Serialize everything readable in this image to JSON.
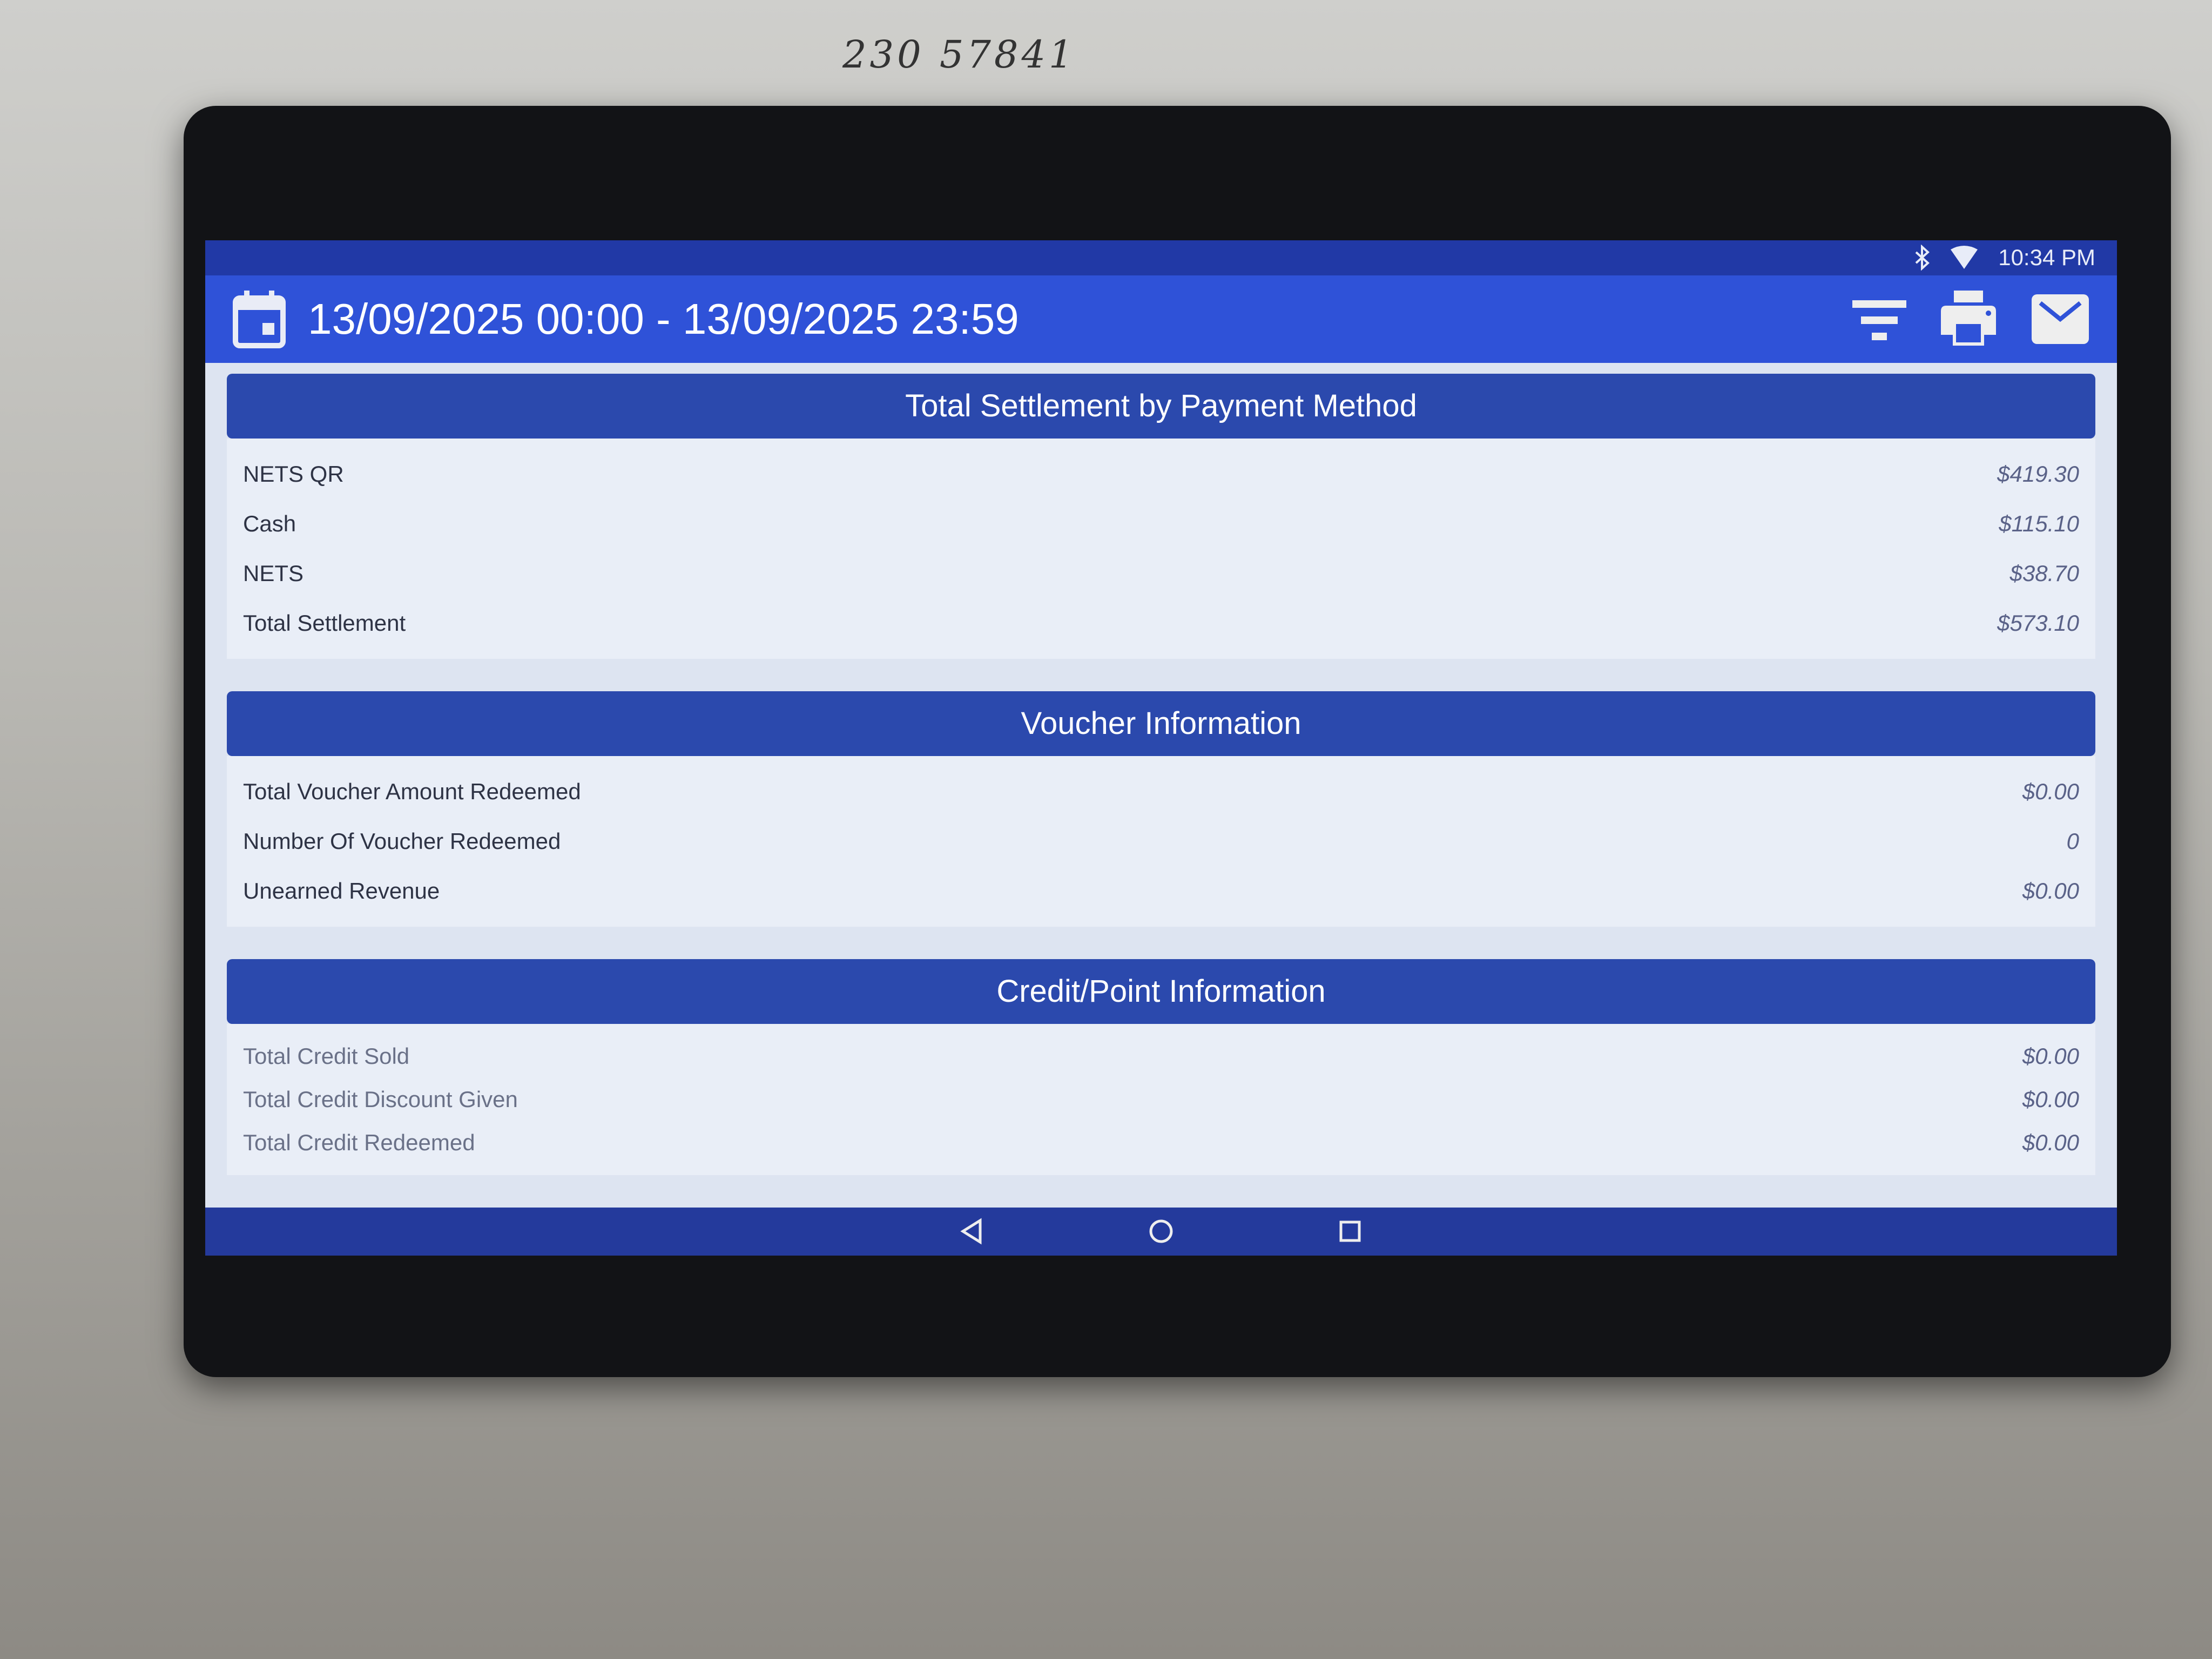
{
  "note": "230 57841",
  "status_bar": {
    "time": "10:34 PM",
    "icons": [
      "bluetooth-icon",
      "wifi-icon"
    ]
  },
  "header": {
    "date_range": "13/09/2025 00:00 - 13/09/2025 23:59",
    "icons": [
      "calendar-icon",
      "filter-icon",
      "print-icon",
      "email-icon"
    ]
  },
  "sections": [
    {
      "title": "Total Settlement by Payment Method",
      "rows": [
        {
          "label": "NETS QR",
          "value": "$419.30"
        },
        {
          "label": "Cash",
          "value": "$115.10"
        },
        {
          "label": "NETS",
          "value": "$38.70"
        },
        {
          "label": "Total Settlement",
          "value": "$573.10"
        }
      ]
    },
    {
      "title": "Voucher Information",
      "rows": [
        {
          "label": "Total Voucher Amount Redeemed",
          "value": "$0.00"
        },
        {
          "label": "Number Of Voucher Redeemed",
          "value": "0"
        },
        {
          "label": "Unearned Revenue",
          "value": "$0.00"
        }
      ]
    },
    {
      "title": "Credit/Point Information",
      "rows": [
        {
          "label": "Total Credit Sold",
          "value": "$0.00"
        },
        {
          "label": "Total Credit Discount Given",
          "value": "$0.00"
        },
        {
          "label": "Total Credit Redeemed",
          "value": "$0.00"
        }
      ]
    }
  ],
  "nav": [
    "back-icon",
    "home-icon",
    "recents-icon"
  ],
  "colors": {
    "header": "#2f52d8",
    "section_header": "#2b49ad",
    "status_bar": "#2139a6",
    "background": "#dde4f1"
  }
}
